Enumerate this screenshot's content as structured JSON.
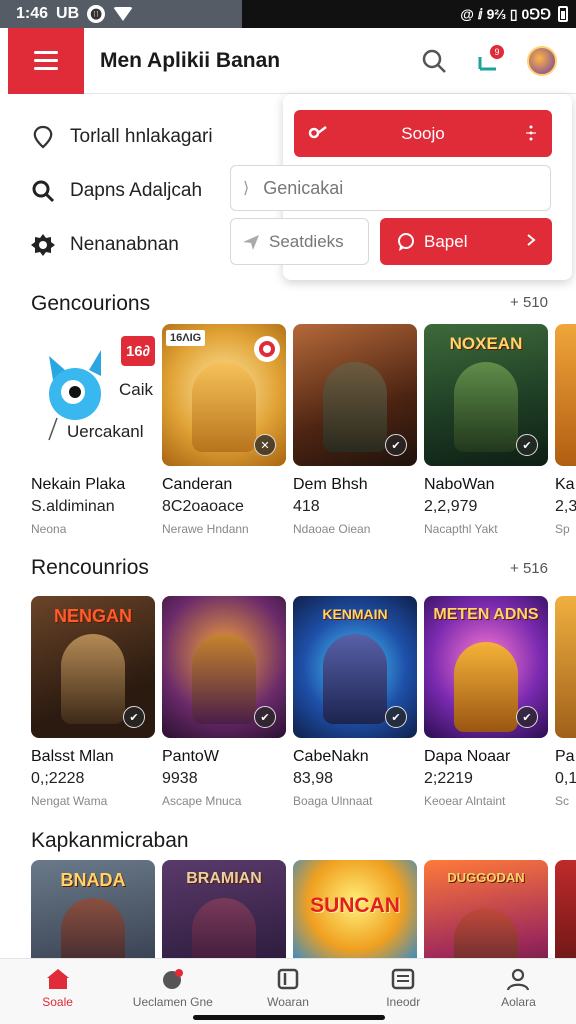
{
  "status_bar": {
    "time": "1:46",
    "carrier": "UB",
    "badge": "⓫",
    "right_text": "@ ⅈ 9⅔ ▯ 0⅁⅁"
  },
  "app_bar": {
    "title": "Men Aplikii Banan",
    "notif_count": "9"
  },
  "side_menu": [
    {
      "icon": "location-pin-icon",
      "label": "Torlall hnlakagari"
    },
    {
      "icon": "search-icon",
      "label": "Dapns Adaljcah"
    },
    {
      "icon": "gear-icon",
      "label": "Nenanabnan"
    }
  ],
  "panel": {
    "primary_button": "Soojo",
    "search_placeholder": "Genicakai",
    "chip_label": "Seatdieks",
    "action_button": "Bapel"
  },
  "sections": [
    {
      "title": "Gencourions",
      "more": "+ 510",
      "cards": [
        {
          "thumb_text_top": "16∂",
          "thumb_text_mid": "Caik",
          "thumb_text_bot": "Uercakanl",
          "name": "Nekain Plaka",
          "count": "S.aldiminan",
          "sub": "Neona",
          "theme": "mascot"
        },
        {
          "thumb_text_top": "16ΛIG",
          "name": "Canderan",
          "count": "8C2oaoace",
          "sub": "Nerawe Hndann",
          "theme": "gold"
        },
        {
          "name": "Dem Bhsh",
          "count": "418",
          "sub": "Ndaoae Oiean",
          "theme": "warrior"
        },
        {
          "thumb_text_top": "NOXEAN",
          "name": "NaboWan",
          "count": "2,2,979",
          "sub": "Nacapthl Yakt",
          "theme": "green"
        },
        {
          "name": "Ka",
          "count": "2,3",
          "sub": "Sp",
          "theme": "orange"
        }
      ]
    },
    {
      "title": "Rencounrios",
      "more": "+ 516",
      "cards": [
        {
          "thumb_text_top": "NENGAN",
          "name": "Balsst Mlan",
          "count": "0,;2228",
          "sub": "Nengat Wama",
          "theme": "dark-warrior"
        },
        {
          "name": "PantoW",
          "count": "9938",
          "sub": "Ascape Mnuca",
          "theme": "fire"
        },
        {
          "thumb_text_top": "KENMAIN",
          "name": "CabeNakn",
          "count": "83,98",
          "sub": "Boaga Ulnnaat",
          "theme": "blue"
        },
        {
          "thumb_text_top": "METEN ADNS",
          "name": "Dapa Noaar",
          "count": "2;2219",
          "sub": "Keoear Alntaint",
          "theme": "purple"
        },
        {
          "name": "Pa",
          "count": "0,1",
          "sub": "Sc",
          "theme": "orange"
        }
      ]
    },
    {
      "title": "Kapkanmicraban",
      "cards": [
        {
          "thumb_text_top": "BNADA",
          "theme": "team"
        },
        {
          "thumb_text_top": "BRAMIAN",
          "theme": "dark-purple"
        },
        {
          "thumb_text_top": "SUNCAN",
          "theme": "sun"
        },
        {
          "thumb_text_top": "DUGGODAN",
          "theme": "sunset"
        },
        {
          "theme": "red"
        }
      ]
    }
  ],
  "bottom_nav": [
    {
      "label": "Soale",
      "icon": "home-icon",
      "active": true
    },
    {
      "label": "Ueclamen Gne",
      "icon": "game-icon",
      "active": false
    },
    {
      "label": "Woaran",
      "icon": "library-icon",
      "active": false
    },
    {
      "label": "Ineodr",
      "icon": "inbox-icon",
      "active": false
    },
    {
      "label": "Aolara",
      "icon": "profile-icon",
      "active": false
    }
  ],
  "colors": {
    "accent": "#e02b38",
    "text": "#1a1a1a",
    "muted": "#888888"
  }
}
